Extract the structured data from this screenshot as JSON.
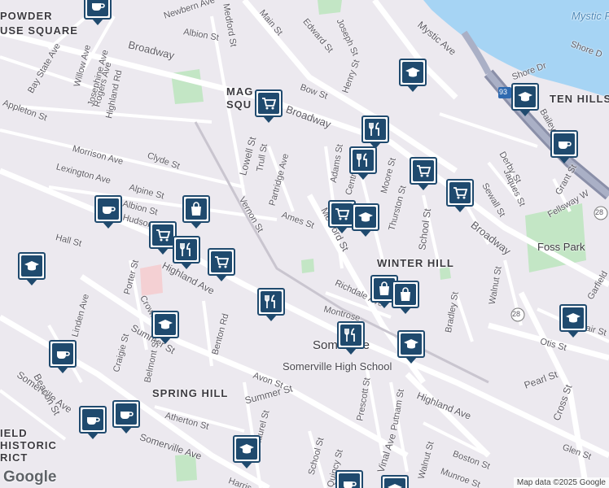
{
  "map": {
    "attribution": "Map data ©2025 Google",
    "logo": "Google",
    "colors": {
      "land": "#ece9ef",
      "road": "#ffffff",
      "water": "#a6d4f4",
      "park": "#c3e6c5",
      "highway": "#8a8fa8",
      "pin": "#1f4a6e"
    },
    "labels": {
      "powder_house_1": "POWDER",
      "powder_house_2": "USE SQUARE",
      "magoun_1": "MAG",
      "magoun_2": "SQU",
      "ten_hills": "TEN HILLS",
      "winter_hill": "WINTER HILL",
      "spring_hill": "SPRING HILL",
      "historic_1": "IELD",
      "historic_2": "HISTORIC",
      "historic_3": "RICT",
      "somerville": "Somerville",
      "somerville_hs": "Somerville High School",
      "foss_park": "Foss Park",
      "mystic": "Mystic R",
      "route_93": "93",
      "route_28a": "28",
      "route_28b": "28",
      "streets": {
        "broadway_w": "Broadway",
        "broadway_c": "Broadway",
        "broadway_e": "Broadway",
        "main_st": "Main St",
        "mystic_ave": "Mystic Ave",
        "medford_st_n": "Medford St",
        "medford_st_c": "Medford St",
        "lowell_st": "Lowell St",
        "highland_ave_w": "Highland Ave",
        "highland_ave_e": "Highland Ave",
        "summer_st_w": "Summer St",
        "summer_st_c": "Summer St",
        "school_st": "School St",
        "cross_st": "Cross St",
        "pearl_st": "Pearl St",
        "vinal_ave": "Vinal Ave",
        "somerville_ave_w": "Somerville Ave",
        "somerville_ave_s": "Somerville Ave",
        "newbern": "Newbern Ave",
        "albion_n": "Albion St",
        "edward": "Edward St",
        "joseph": "Joseph St",
        "henry": "Henry St",
        "bow": "Bow St",
        "trull": "Trull St",
        "partridge": "Partridge Ave",
        "vernon": "Vernon St",
        "ames": "Ames St",
        "adams": "Adams St",
        "central": "Central St",
        "thurston": "Thurston St",
        "richdale": "Richdale Ave",
        "bradley": "Bradley St",
        "walnut_n": "Walnut St",
        "walnut_s": "Walnut St",
        "otis": "Otis St",
        "bonair": "Bonair St",
        "garfield": "Garfield",
        "derby": "Derby St",
        "jaques": "Jaques St",
        "grant": "Grant St",
        "fellsway": "Fellsway W",
        "sewall": "Sewall St",
        "shore_dr": "Shore Dr",
        "shore_dr2": "Shore D",
        "bailey": "Bailey",
        "bay_state": "Bay State Ave",
        "willow": "Willow Ave",
        "josephine": "Josephine Ave",
        "rogers": "Rogers Ave",
        "highland_rd": "Highland Rd",
        "appleton": "Appleton St",
        "morrison": "Morrison Ave",
        "clyde": "Clyde St",
        "lexington": "Lexington Ave",
        "alpine": "Alpine St",
        "albion_s": "Albion St",
        "hudson": "Hudson St",
        "hall": "Hall St",
        "porter": "Porter St",
        "crown": "Crown St",
        "linden": "Linden Ave",
        "craigie": "Craigie St",
        "belmont": "Belmont St",
        "benton": "Benton Rd",
        "avon": "Avon St",
        "atherton": "Atherton St",
        "laurel": "Laurel St",
        "prescott": "Prescott St",
        "putnam": "Putnam St",
        "quincy": "Quincy St",
        "school_s": "School St",
        "boston": "Boston St",
        "munroe": "Munroe St",
        "glen": "Glen St",
        "beacon": "Beacon St",
        "harris": "Harris",
        "montrose": "Montrose",
        "bedford": "Medford St",
        "moore": "Moore St"
      }
    },
    "pins": [
      {
        "name": "coffee-pin-top",
        "icon": "coffee"
      },
      {
        "name": "shopping-cart-pin-magoun",
        "icon": "cart"
      },
      {
        "name": "school-pin-mystic",
        "icon": "school"
      },
      {
        "name": "school-pin-ten-hills",
        "icon": "school"
      },
      {
        "name": "restaurant-pin-broadway",
        "icon": "restaurant"
      },
      {
        "name": "restaurant-pin-central",
        "icon": "restaurant"
      },
      {
        "name": "coffee-pin-ten-hills",
        "icon": "coffee"
      },
      {
        "name": "shopping-cart-pin-cross",
        "icon": "cart"
      },
      {
        "name": "shopping-cart-pin-sewall",
        "icon": "cart"
      },
      {
        "name": "shopping-cart-pin-medford",
        "icon": "cart"
      },
      {
        "name": "school-pin-medford",
        "icon": "school"
      },
      {
        "name": "shopping-bag-pin-lowell",
        "icon": "bag"
      },
      {
        "name": "coffee-pin-albion",
        "icon": "coffee"
      },
      {
        "name": "shopping-cart-pin-highland",
        "icon": "cart"
      },
      {
        "name": "restaurant-pin-highland",
        "icon": "restaurant"
      },
      {
        "name": "shopping-cart-pin-highland-2",
        "icon": "cart"
      },
      {
        "name": "school-pin-hall",
        "icon": "school"
      },
      {
        "name": "restaurant-pin-summer",
        "icon": "restaurant"
      },
      {
        "name": "shopping-bag-pin-winter-hill",
        "icon": "bag"
      },
      {
        "name": "shopping-bag-pin-winter-hill-2",
        "icon": "bag"
      },
      {
        "name": "school-pin-bonair",
        "icon": "school"
      },
      {
        "name": "school-pin-crown",
        "icon": "school"
      },
      {
        "name": "restaurant-pin-somerville",
        "icon": "restaurant"
      },
      {
        "name": "school-pin-high-school",
        "icon": "school"
      },
      {
        "name": "coffee-pin-linden",
        "icon": "coffee"
      },
      {
        "name": "coffee-pin-somerville-ave",
        "icon": "coffee"
      },
      {
        "name": "coffee-pin-spring-hill",
        "icon": "coffee"
      },
      {
        "name": "school-pin-laurel",
        "icon": "school"
      },
      {
        "name": "coffee-pin-bottom",
        "icon": "coffee"
      },
      {
        "name": "school-pin-bottom",
        "icon": "school"
      }
    ]
  }
}
